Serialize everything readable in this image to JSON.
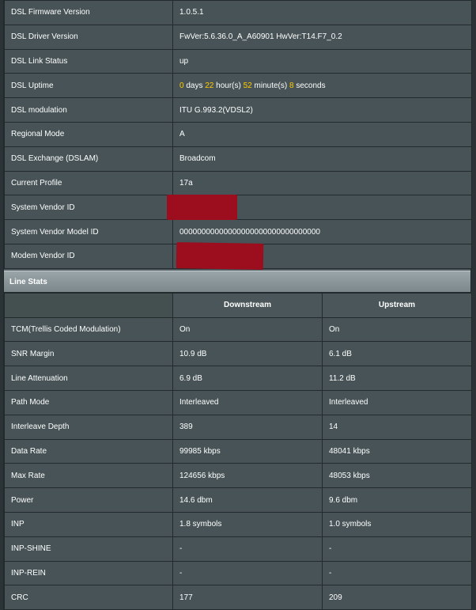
{
  "info_rows": [
    {
      "label": "DSL Firmware Version",
      "value": "1.0.5.1"
    },
    {
      "label": "DSL Driver Version",
      "value": "FwVer:5.6.36.0_A_A60901 HwVer:T14.F7_0.2"
    },
    {
      "label": "DSL Link Status",
      "value": "up"
    },
    {
      "label": "DSL Uptime",
      "uptime": {
        "days": "0",
        "days_word": "days",
        "hours": "22",
        "hours_word": "hour(s)",
        "minutes": "52",
        "minutes_word": "minute(s)",
        "seconds": "8",
        "seconds_word": "seconds"
      }
    },
    {
      "label": "DSL modulation",
      "value": "ITU G.993.2(VDSL2)"
    },
    {
      "label": "Regional Mode",
      "value": "A"
    },
    {
      "label": "DSL Exchange (DSLAM)",
      "value": "Broadcom"
    },
    {
      "label": "Current Profile",
      "value": "17a"
    },
    {
      "label": "System Vendor ID",
      "value": ""
    },
    {
      "label": "System Vendor Model ID",
      "value": "00000000000000000000000000000000"
    },
    {
      "label": "Modem Vendor ID",
      "value": ""
    }
  ],
  "line_stats": {
    "title": "Line Stats",
    "columns": [
      "",
      "Downstream",
      "Upstream"
    ],
    "rows": [
      {
        "label": "TCM(Trellis Coded Modulation)",
        "down": "On",
        "up": "On"
      },
      {
        "label": "SNR Margin",
        "down": "10.9 dB",
        "up": "6.1 dB"
      },
      {
        "label": "Line Attenuation",
        "down": "6.9 dB",
        "up": "11.2 dB"
      },
      {
        "label": "Path Mode",
        "down": "Interleaved",
        "up": "Interleaved"
      },
      {
        "label": "Interleave Depth",
        "down": "389",
        "up": "14"
      },
      {
        "label": "Data Rate",
        "down": "99985 kbps",
        "up": "48041 kbps"
      },
      {
        "label": "Max Rate",
        "down": "124656 kbps",
        "up": "48053 kbps"
      },
      {
        "label": "Power",
        "down": "14.6 dbm",
        "up": "9.6 dbm"
      },
      {
        "label": "INP",
        "down": "1.8 symbols",
        "up": "1.0 symbols"
      },
      {
        "label": "INP-SHINE",
        "down": "-",
        "up": "-"
      },
      {
        "label": "INP-REIN",
        "down": "-",
        "up": "-"
      },
      {
        "label": "CRC",
        "down": "177",
        "up": "209"
      }
    ]
  },
  "colors": {
    "highlight": "#ffcc00",
    "redaction": "#9c0d1d",
    "panel": "#475356"
  }
}
